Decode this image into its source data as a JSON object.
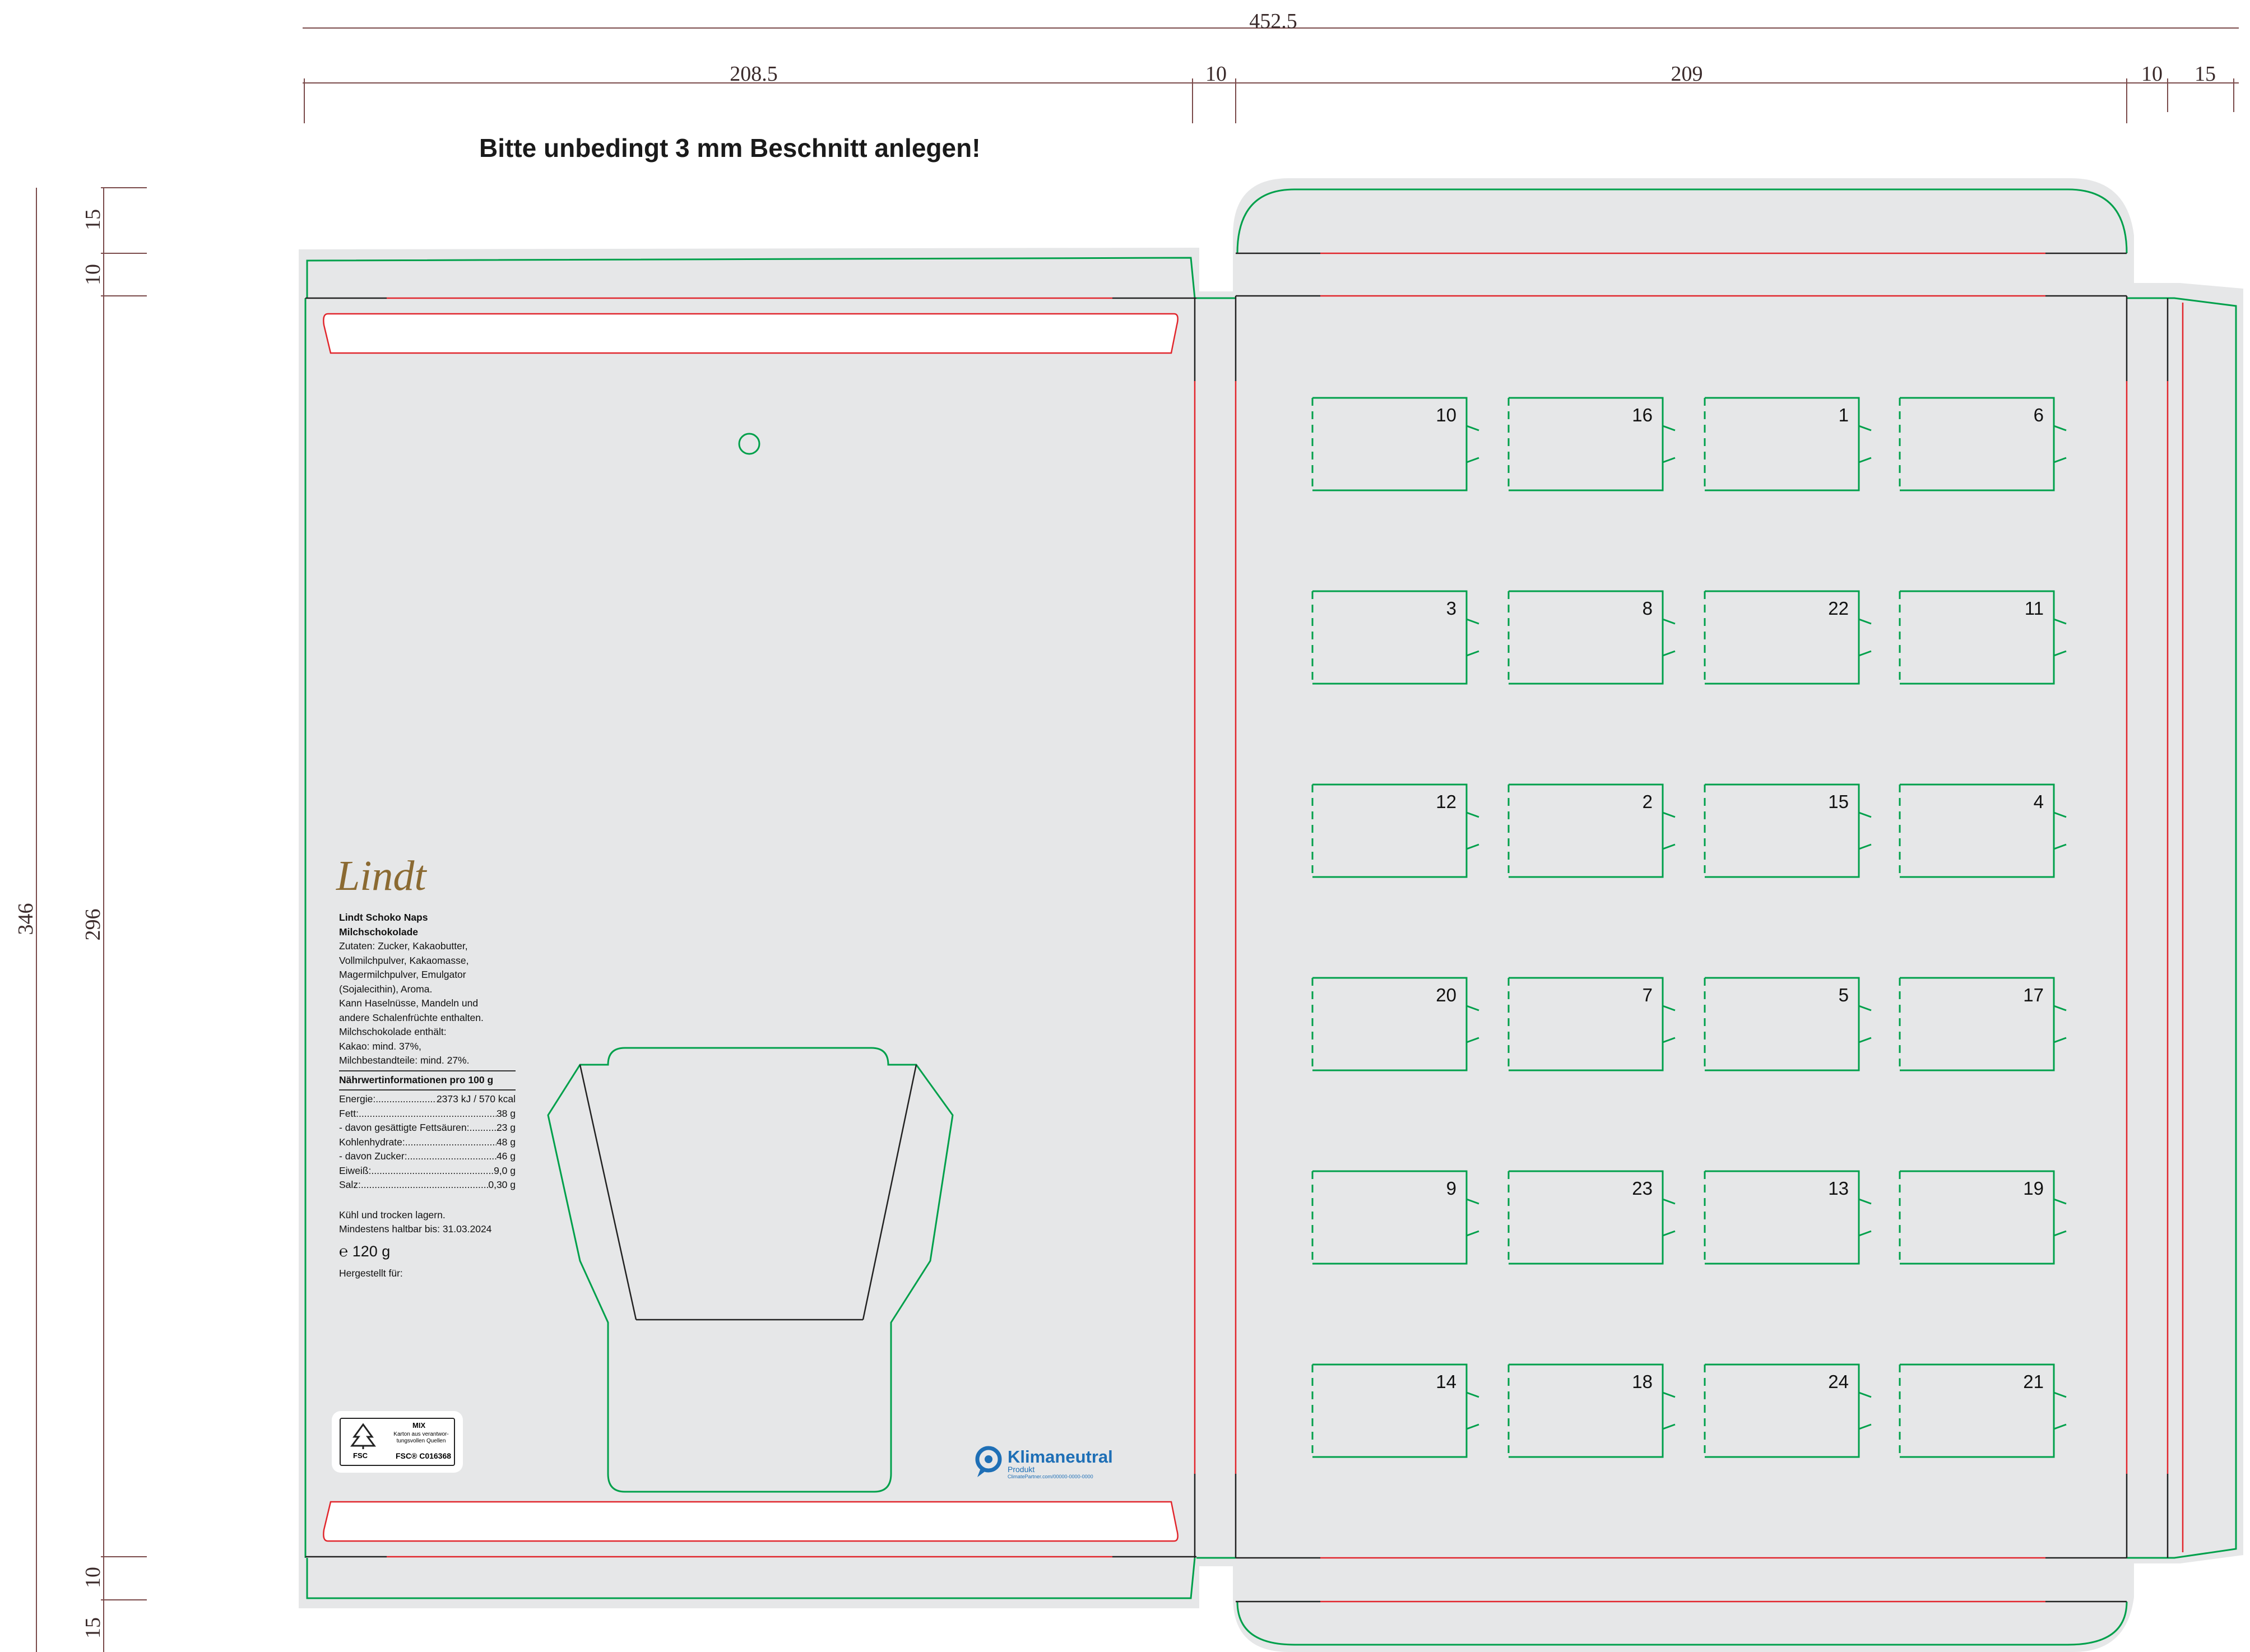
{
  "dimensions": {
    "total_width": "452.5",
    "segments": [
      "208.5",
      "10",
      "209",
      "10",
      "15"
    ],
    "total_height": "346",
    "left_segments": [
      "15",
      "10",
      "296",
      "10",
      "15"
    ]
  },
  "warning": "Bitte unbedingt 3 mm Beschnitt anlegen!",
  "doors": [
    [
      "10",
      "16",
      "1",
      "6"
    ],
    [
      "3",
      "8",
      "22",
      "11"
    ],
    [
      "12",
      "2",
      "15",
      "4"
    ],
    [
      "20",
      "7",
      "5",
      "17"
    ],
    [
      "9",
      "23",
      "13",
      "19"
    ],
    [
      "14",
      "18",
      "24",
      "21"
    ]
  ],
  "product": {
    "brand": "Lindt",
    "name": "Lindt Schoko Naps",
    "type": "Milchschokolade",
    "ingredients": [
      "Zutaten: Zucker, Kakaobutter,",
      "Vollmilchpulver, Kakaomasse,",
      "Magermilchpulver, Emulgator",
      "(Sojalecithin), Aroma.",
      "Kann Haselnüsse, Mandeln und",
      "andere Schalenfrüchte enthalten.",
      "Milchschokolade enthält:",
      "Kakao: mind. 37%,",
      "Milchbestandteile: mind. 27%."
    ],
    "nutrition_title": "Nährwertinformationen pro 100 g",
    "nutrition": [
      {
        "k": "Energie:",
        "v": "2373 kJ / 570 kcal"
      },
      {
        "k": "Fett:",
        "v": "38 g"
      },
      {
        "k": "  - davon gesättigte Fettsäuren:",
        "v": "23 g"
      },
      {
        "k": "Kohlenhydrate:",
        "v": "48 g"
      },
      {
        "k": "  - davon Zucker:",
        "v": "46 g"
      },
      {
        "k": "Eiweiß:",
        "v": "9,0 g"
      },
      {
        "k": "Salz:",
        "v": "0,30 g"
      }
    ],
    "storage": "Kühl und trocken lagern.",
    "best_before": "Mindestens haltbar bis: 31.03.2024",
    "weight": "℮ 120 g",
    "made_for": "Hergestellt für:"
  },
  "fsc": {
    "mix": "MIX",
    "text": "Karton aus verantwor-tungsvollen Quellen",
    "code": "FSC® C016368",
    "logo": "FSC"
  },
  "klima": {
    "title": "Klimaneutral",
    "sub": "Produkt",
    "url": "ClimatePartner.com/00000-0000-0000"
  },
  "colors": {
    "panel": "#e6e7e8",
    "crease": "#e1262c",
    "cut": "#00a04b",
    "fold": "#222222",
    "dim": "#7a4a4a"
  }
}
